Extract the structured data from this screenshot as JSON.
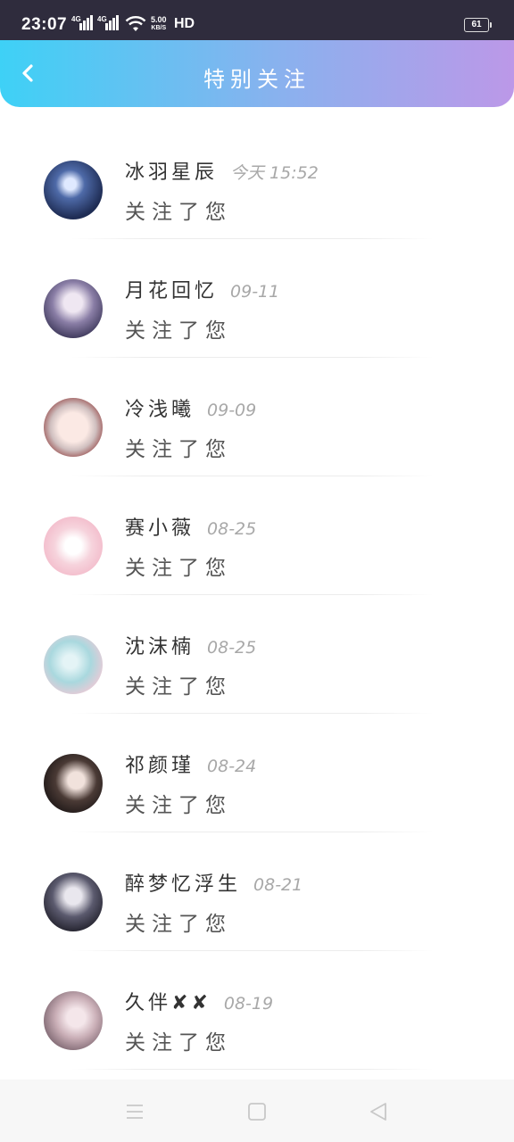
{
  "status_bar": {
    "time": "23:07",
    "signal_1_label": "4G",
    "signal_2_label": "4G",
    "speed_value": "5.00",
    "speed_unit": "KB/S",
    "hd_label": "HD",
    "battery": "61"
  },
  "header": {
    "title": "特别关注",
    "back_icon": "chevron-left-icon",
    "gradient": [
      "#3ed1f6",
      "#bc98e8"
    ]
  },
  "follows": [
    {
      "name": "冰羽星辰",
      "time": "今天 15:52",
      "message": "关注了您"
    },
    {
      "name": "月花回忆",
      "time": "09-11",
      "message": "关注了您"
    },
    {
      "name": "冷浅曦",
      "time": "09-09",
      "message": "关注了您"
    },
    {
      "name": "赛小薇",
      "time": "08-25",
      "message": "关注了您"
    },
    {
      "name": "沈沫楠",
      "time": "08-25",
      "message": "关注了您"
    },
    {
      "name": "祁颜瑾",
      "time": "08-24",
      "message": "关注了您"
    },
    {
      "name": "醉梦忆浮生",
      "time": "08-21",
      "message": "关注了您"
    },
    {
      "name": "久伴✘✘",
      "time": "08-19",
      "message": "关注了您"
    }
  ],
  "nav_bar": {
    "icons": [
      "menu-icon",
      "home-square-icon",
      "back-triangle-icon"
    ]
  }
}
